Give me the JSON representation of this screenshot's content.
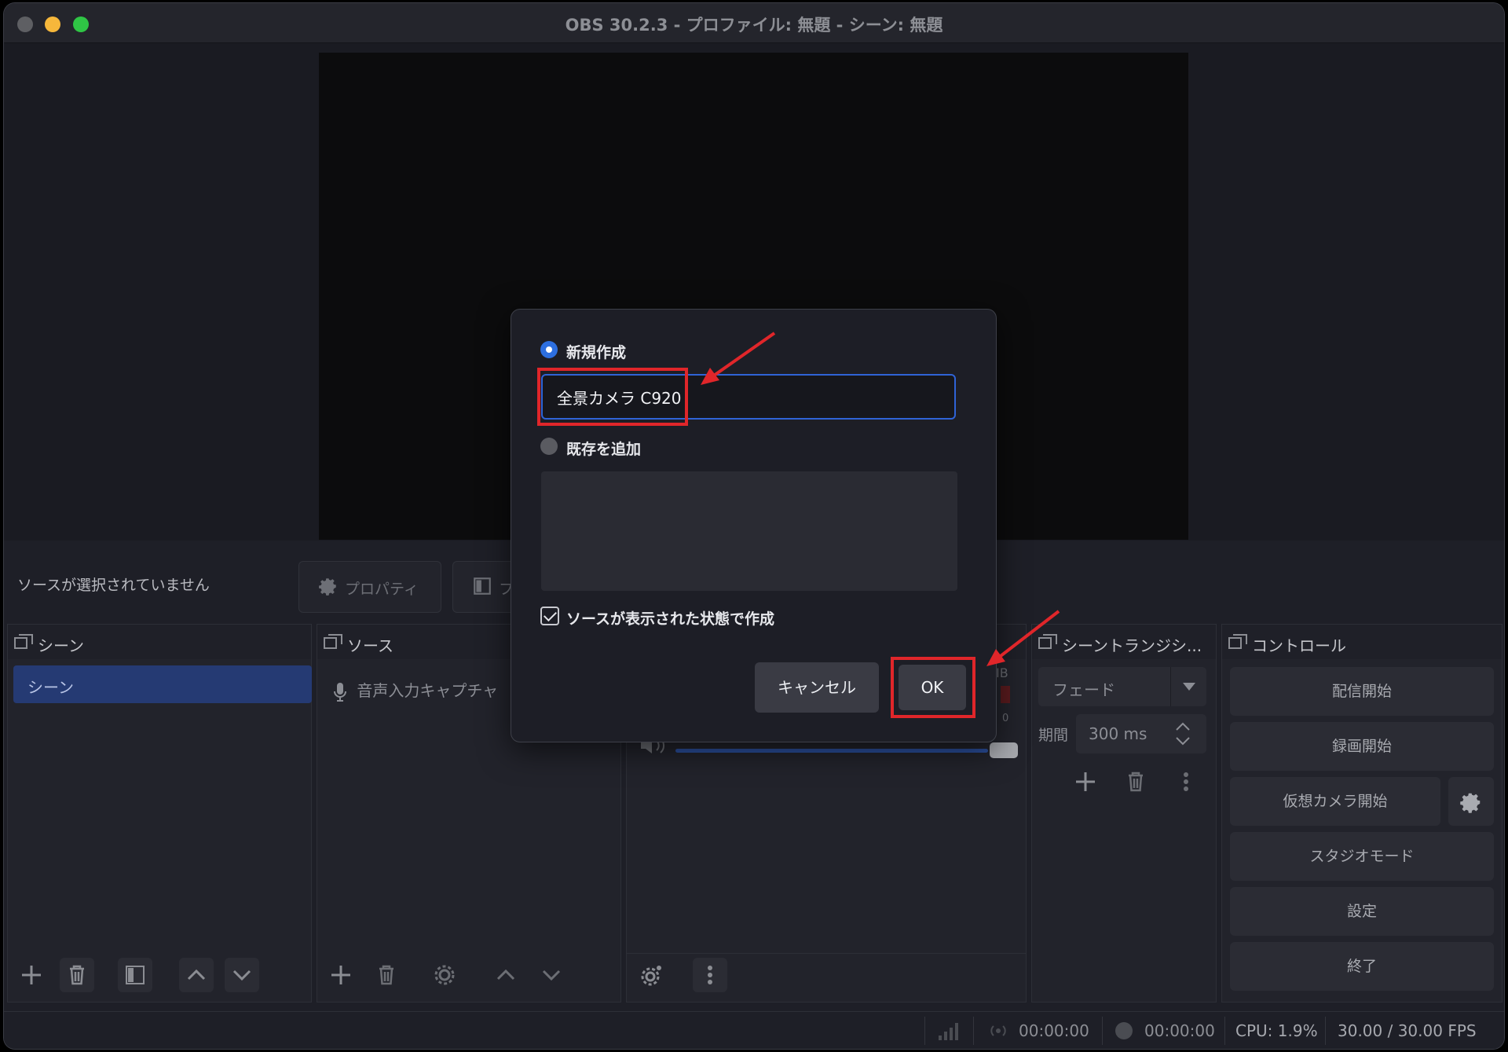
{
  "window": {
    "title": "OBS 30.2.3 - プロファイル: 無題 - シーン: 無題"
  },
  "properties_bar": {
    "no_source_text": "ソースが選択されていません",
    "properties_label": "プロパティ",
    "filters_label": "フ"
  },
  "scenes_dock": {
    "title": "シーン",
    "items": [
      "シーン"
    ]
  },
  "sources_dock": {
    "title": "ソース",
    "items": [
      {
        "label": "音声入力キャプチャ",
        "icon": "microphone-icon"
      }
    ]
  },
  "mixer_dock": {
    "meter_label": "IB",
    "meter_zero": "0"
  },
  "transitions_dock": {
    "title": "シーントランジシ...",
    "transition": "フェード",
    "duration_label": "期間",
    "duration_value": "300 ms"
  },
  "controls_dock": {
    "title": "コントロール",
    "buttons": [
      "配信開始",
      "録画開始",
      "仮想カメラ開始",
      "スタジオモード",
      "設定",
      "終了"
    ]
  },
  "status_bar": {
    "stream_time": "00:00:00",
    "record_time": "00:00:00",
    "cpu": "CPU: 1.9%",
    "fps": "30.00 / 30.00 FPS"
  },
  "dialog": {
    "new_option": "新規作成",
    "name_value": "全景カメラ C920",
    "existing_option": "既存を追加",
    "visible_checkbox": "ソースが表示された状態で作成",
    "cancel": "キャンセル",
    "ok": "OK"
  },
  "annotation_color": "#e0262a",
  "accent_color": "#2d6fe0"
}
